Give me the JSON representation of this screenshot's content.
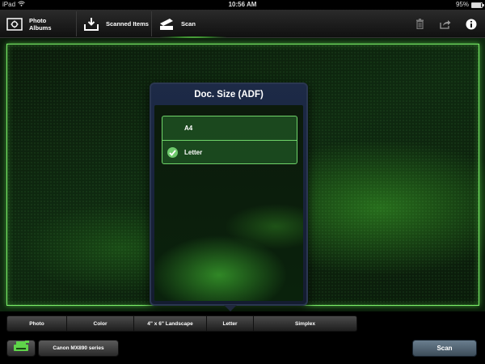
{
  "status_bar": {
    "device": "iPad",
    "time": "10:56 AM",
    "battery_text": "95%",
    "battery_level": 0.95,
    "wifi_icon": "wifi-icon"
  },
  "toolbar": {
    "photo_albums_label_line1": "Photo",
    "photo_albums_label_line2": "Albums",
    "scanned_items_label": "Scanned Items",
    "scan_label": "Scan",
    "icons": [
      "photo-albums-icon",
      "scanned-items-icon",
      "scan-icon",
      "trash-icon",
      "share-icon",
      "info-icon"
    ]
  },
  "popover": {
    "title": "Doc. Size (ADF)",
    "options": [
      {
        "label": "A4",
        "selected": false
      },
      {
        "label": "Letter",
        "selected": true
      }
    ]
  },
  "settings_bar": {
    "segments": [
      "Photo",
      "Color",
      "4\" x 6\" Landscape",
      "Letter",
      "Simplex"
    ]
  },
  "bottom_bar": {
    "printer_name": "Canon MX890 series",
    "scan_button": "Scan"
  },
  "colors": {
    "accent_green": "#7cf06a",
    "popover_navy": "#1d2a47",
    "scan_button": "#5a6e7e"
  }
}
